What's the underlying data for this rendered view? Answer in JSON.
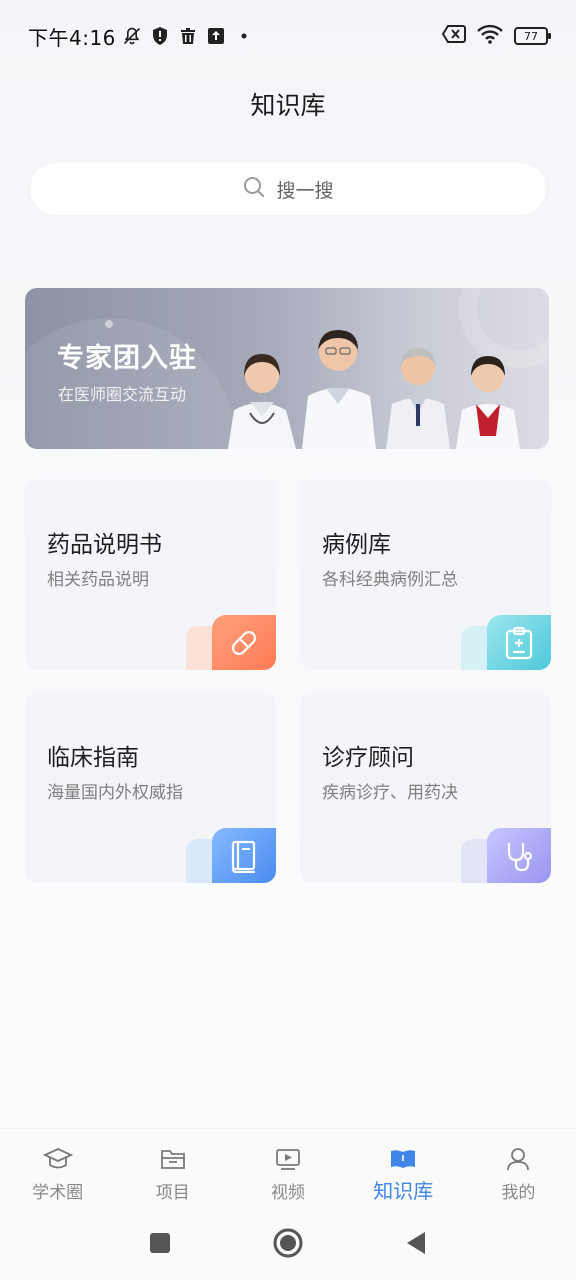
{
  "status_bar": {
    "time": "下午4:16",
    "battery": "77",
    "icons_left": [
      "bell-muted-icon",
      "shield-icon",
      "trash-icon",
      "upload-icon",
      "dot-icon"
    ],
    "icons_right": [
      "sim-off-icon",
      "wifi-icon",
      "battery-icon"
    ]
  },
  "header": {
    "title": "知识库"
  },
  "search": {
    "placeholder": "搜一搜"
  },
  "banner": {
    "title": "专家团入驻",
    "subtitle": "在医师圈交流互动"
  },
  "cards": [
    {
      "title": "药品说明书",
      "subtitle": "相关药品说明",
      "icon": "pill-icon",
      "color_from": "#ff9a73",
      "color_to": "#ff7e5a",
      "back_color": "#fbe2d8"
    },
    {
      "title": "病例库",
      "subtitle": "各科经典病例汇总",
      "icon": "clipboard-icon",
      "color_from": "#8fe3ec",
      "color_to": "#4ecbdc",
      "back_color": "#d6f1f5"
    },
    {
      "title": "临床指南",
      "subtitle": "海量国内外权威指",
      "icon": "book-icon",
      "color_from": "#7eb4ff",
      "color_to": "#4d8ff0",
      "back_color": "#dbe7fa"
    },
    {
      "title": "诊疗顾问",
      "subtitle": "疾病诊疗、用药决",
      "icon": "stethoscope-icon",
      "color_from": "#c3c2ff",
      "color_to": "#9a97f2",
      "back_color": "#e4e4f8"
    }
  ],
  "tabbar": {
    "items": [
      {
        "label": "学术圈",
        "icon": "graduation-cap-icon",
        "active": false
      },
      {
        "label": "项目",
        "icon": "folder-icon",
        "active": false
      },
      {
        "label": "视频",
        "icon": "video-play-icon",
        "active": false
      },
      {
        "label": "知识库",
        "icon": "open-book-icon",
        "active": true
      },
      {
        "label": "我的",
        "icon": "user-icon",
        "active": false
      }
    ],
    "active_color": "#3f86e8",
    "inactive_color": "#8a8a8a"
  },
  "system_nav": [
    "square-nav-icon",
    "home-circle-icon",
    "back-triangle-icon"
  ]
}
